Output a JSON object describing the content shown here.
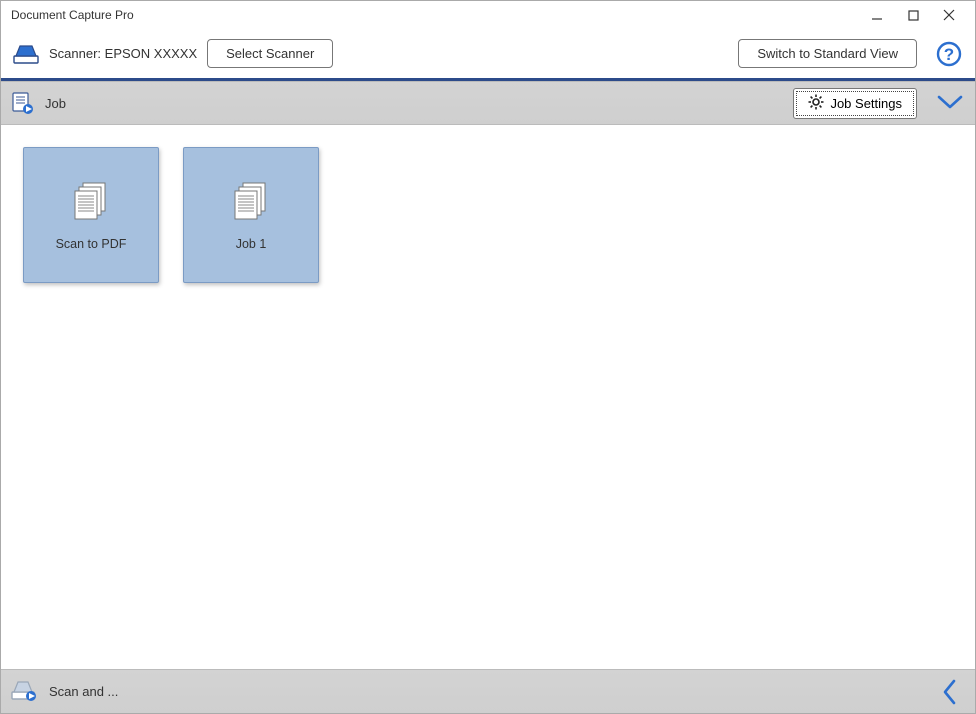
{
  "window": {
    "title": "Document Capture Pro"
  },
  "toolbar": {
    "scanner_label": "Scanner: EPSON XXXXX",
    "select_scanner": "Select Scanner",
    "switch_view": "Switch to Standard View"
  },
  "section": {
    "job_title": "Job",
    "job_settings": "Job Settings"
  },
  "jobs": [
    {
      "label": "Scan to PDF"
    },
    {
      "label": "Job 1"
    }
  ],
  "footer": {
    "label": "Scan and ..."
  },
  "colors": {
    "accent": "#2c4b8a",
    "card_bg": "#a6c0de"
  }
}
